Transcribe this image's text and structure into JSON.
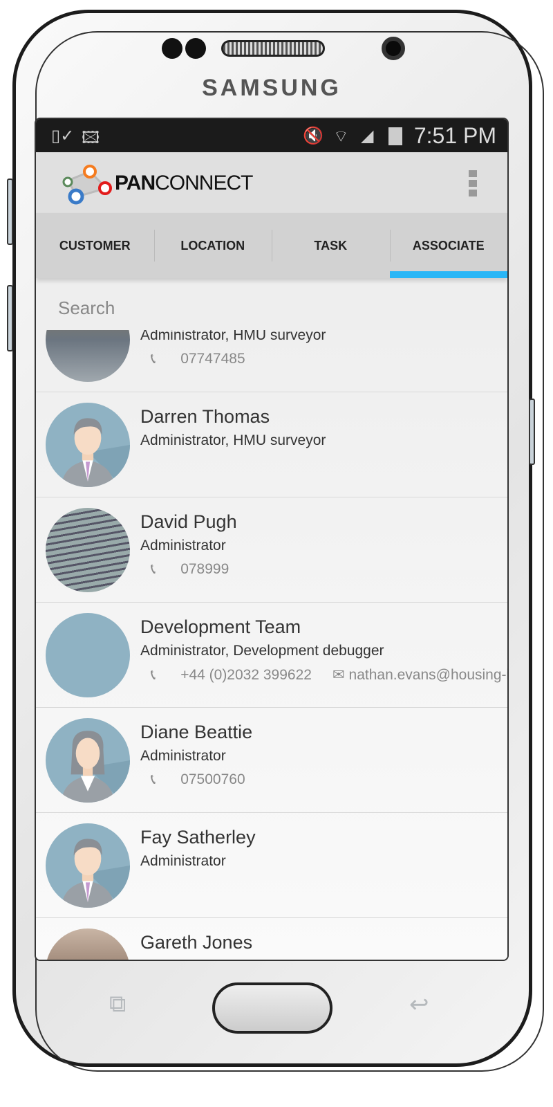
{
  "device": {
    "brand": "SAMSUNG"
  },
  "status_bar": {
    "time": "7:51 PM",
    "icons": [
      "screenshot-check-icon",
      "image-icon",
      "mute-icon",
      "wifi-icon",
      "signal-icon",
      "battery-icon"
    ]
  },
  "app": {
    "logo_bold": "PAN",
    "logo_light": "CONNECT",
    "menu_icon": "overflow-menu-icon"
  },
  "tabs": [
    {
      "label": "CUSTOMER"
    },
    {
      "label": "LOCATION"
    },
    {
      "label": "TASK"
    },
    {
      "label": "ASSOCIATE",
      "active": true
    }
  ],
  "accent": "#29b6f6",
  "search": {
    "placeholder": "Search"
  },
  "associates": [
    {
      "name": "",
      "role": "Administrator, HMU surveyor",
      "phone": "07747485",
      "email": "",
      "avatar": "photo"
    },
    {
      "name": "Darren Thomas",
      "role": "Administrator, HMU surveyor",
      "phone": "",
      "email": "",
      "avatar": "male-placeholder"
    },
    {
      "name": "David Pugh",
      "role": "Administrator",
      "phone": "078999",
      "email": "",
      "avatar": "photo"
    },
    {
      "name": "Development Team",
      "role": "Administrator, Development debugger",
      "phone": "+44 (0)2032 399622",
      "email": "nathan.evans@housing-i...",
      "avatar": "photo"
    },
    {
      "name": "Diane Beattie",
      "role": "Administrator",
      "phone": "07500760",
      "email": "",
      "avatar": "female-placeholder"
    },
    {
      "name": "Fay Satherley",
      "role": "Administrator",
      "phone": "",
      "email": "",
      "avatar": "male-placeholder"
    },
    {
      "name": "Gareth Jones",
      "role": "",
      "phone": "",
      "email": "",
      "avatar": "photo"
    }
  ]
}
